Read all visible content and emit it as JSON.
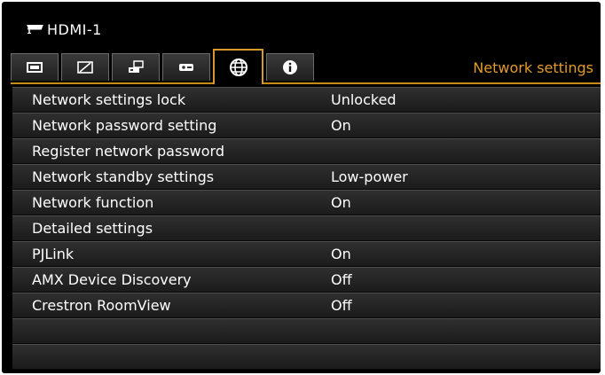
{
  "source": {
    "badge": "1",
    "name": "HDMI-1"
  },
  "tabs": [
    {
      "icon": "screen-icon"
    },
    {
      "icon": "image-adjust-icon"
    },
    {
      "icon": "installation-icon"
    },
    {
      "icon": "system-icon"
    },
    {
      "icon": "network-globe-icon",
      "active": true
    },
    {
      "icon": "info-icon"
    }
  ],
  "page_title": "Network settings",
  "settings": [
    {
      "label": "Network settings lock",
      "value": "Unlocked"
    },
    {
      "label": "Network password setting",
      "value": "On"
    },
    {
      "label": "Register network password",
      "value": ""
    },
    {
      "label": "Network standby settings",
      "value": "Low-power"
    },
    {
      "label": "Network function",
      "value": "On"
    },
    {
      "label": "Detailed settings",
      "value": ""
    },
    {
      "label": "PJLink",
      "value": "On"
    },
    {
      "label": "AMX Device Discovery",
      "value": "Off"
    },
    {
      "label": "Crestron RoomView",
      "value": "Off"
    },
    {
      "label": "",
      "value": ""
    },
    {
      "label": "",
      "value": ""
    }
  ],
  "colors": {
    "accent": "#e29b2a",
    "background": "#000000",
    "text": "#ffffff"
  }
}
